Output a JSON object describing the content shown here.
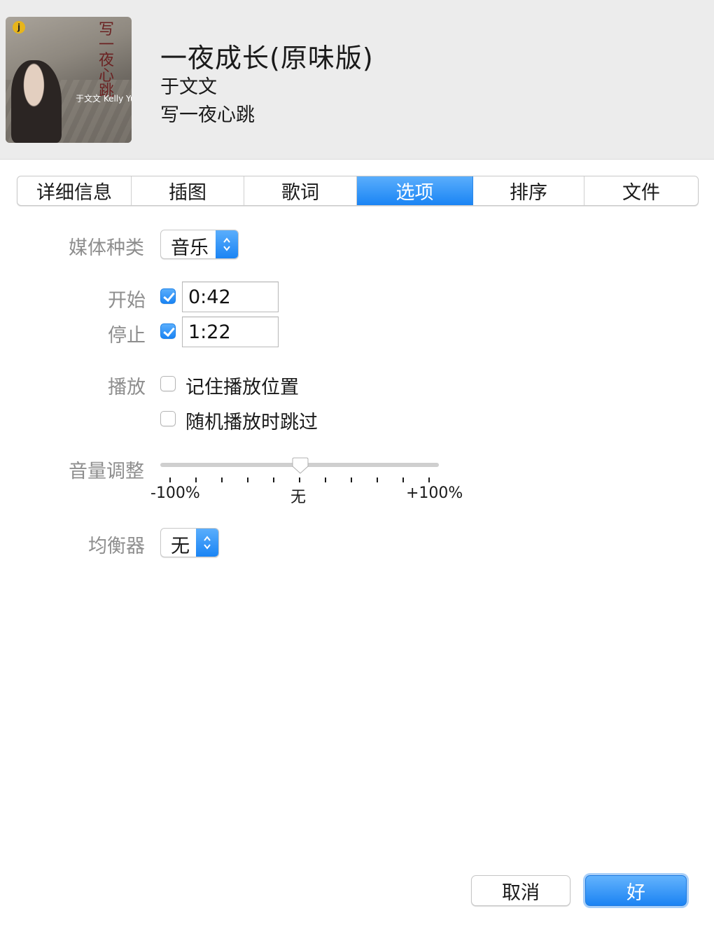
{
  "header": {
    "title": "一夜成长(原味版)",
    "artist": "于文文",
    "album": "写一夜心跳",
    "artwork": {
      "title_text": "写一夜心跳",
      "subtitle_text": "于文文 Kelly Yu",
      "logo_text": "j"
    }
  },
  "tabs": [
    {
      "label": "详细信息",
      "active": false
    },
    {
      "label": "插图",
      "active": false
    },
    {
      "label": "歌词",
      "active": false
    },
    {
      "label": "选项",
      "active": true
    },
    {
      "label": "排序",
      "active": false
    },
    {
      "label": "文件",
      "active": false
    }
  ],
  "form": {
    "media_kind": {
      "label": "媒体种类",
      "value": "音乐"
    },
    "start": {
      "label": "开始",
      "checked": true,
      "value": "0:42"
    },
    "stop": {
      "label": "停止",
      "checked": true,
      "value": "1:22"
    },
    "playback": {
      "label": "播放",
      "remember_position": {
        "label": "记住播放位置",
        "checked": false
      },
      "skip_when_shuffling": {
        "label": "随机播放时跳过",
        "checked": false
      }
    },
    "volume_adjust": {
      "label": "音量调整",
      "value_percent": 0,
      "tick_labels": {
        "min": "-100%",
        "mid": "无",
        "max": "+100%"
      }
    },
    "equalizer": {
      "label": "均衡器",
      "value": "无"
    }
  },
  "buttons": {
    "cancel": "取消",
    "ok": "好"
  },
  "colors": {
    "accent": "#1a84f4",
    "header_bg": "#ececec"
  }
}
